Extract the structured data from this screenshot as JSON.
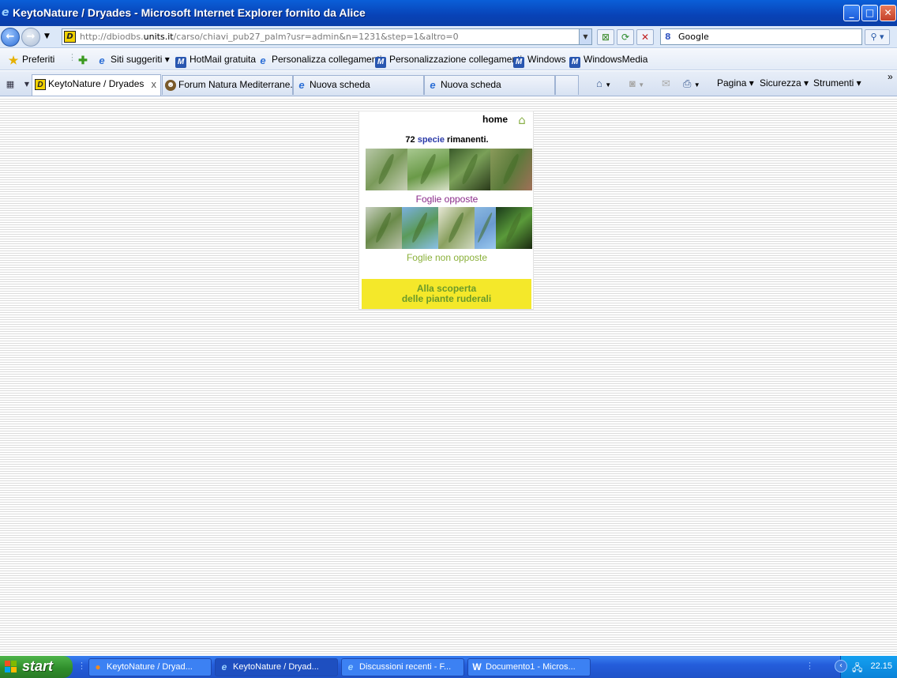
{
  "window": {
    "title": "KeytoNature / Dryades - Microsoft Internet Explorer fornito da Alice",
    "minimize": "_",
    "maximize": "□",
    "close": "✕"
  },
  "address_bar": {
    "url_prefix": "http://dbiodbs.",
    "url_host": "units.it",
    "url_path": "/carso/chiavi_pub27_palm?usr=admin&n=1231&step=1&altro=0",
    "search_value": "Google",
    "search_logo": "8"
  },
  "favorites_bar": {
    "favorites_label": "Preferiti",
    "items": [
      {
        "label": "Siti suggeriti ▾",
        "icon": "ie-page-icon"
      },
      {
        "label": "HotMail gratuita",
        "icon": "msn-icon"
      },
      {
        "label": "Personalizza collegamenti",
        "icon": "ie-page-icon"
      },
      {
        "label": "Personalizzazione collegamenti",
        "icon": "msn-icon"
      },
      {
        "label": "Windows",
        "icon": "msn-icon"
      },
      {
        "label": "WindowsMedia",
        "icon": "msn-icon"
      }
    ]
  },
  "tabs": [
    {
      "label": "KeytoNature / Dryades",
      "icon": "dryades-icon",
      "active": true
    },
    {
      "label": "Forum Natura Mediterrane...",
      "icon": "forum-icon",
      "active": false
    },
    {
      "label": "Nuova scheda",
      "icon": "ie-icon",
      "active": false
    },
    {
      "label": "Nuova scheda",
      "icon": "ie-icon",
      "active": false
    }
  ],
  "command_bar": {
    "page": "Pagina ▾",
    "security": "Sicurezza ▾",
    "tools": "Strumenti ▾",
    "more": "»"
  },
  "content": {
    "home_label": "home",
    "count_number": "72",
    "count_species": "specie",
    "count_suffix": "rimanenti.",
    "choice1_label": "Foglie opposte",
    "choice2_label": "Foglie non opposte",
    "banner_line1": "Alla scoperta",
    "banner_line2": "delle piante ruderali",
    "colors": {
      "choice1": "#8a2a8a",
      "choice2": "#8ab03a",
      "species_link": "#2a3aa8",
      "banner_bg": "#f4e82a",
      "banner_text": "#6a9a2a"
    }
  },
  "taskbar": {
    "start_label": "start",
    "tasks": [
      {
        "label": "KeytoNature / Dryad...",
        "icon": "firefox-icon",
        "active": false
      },
      {
        "label": "KeytoNature / Dryad...",
        "icon": "ie-icon",
        "active": true
      },
      {
        "label": "Discussioni recenti - F...",
        "icon": "ie-icon",
        "active": false
      },
      {
        "label": "Documento1 - Micros...",
        "icon": "word-icon",
        "active": false
      }
    ],
    "clock": "22.15"
  }
}
